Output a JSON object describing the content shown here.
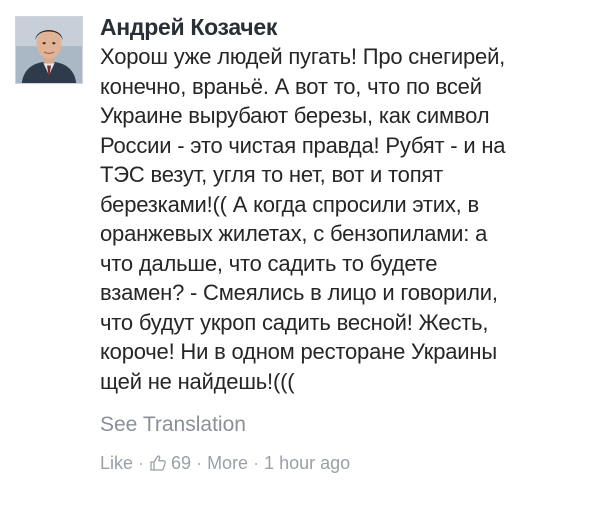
{
  "comment": {
    "author": "Андрей Козачек",
    "lines": [
      "Хорош уже людей пугать! Про снегирей,",
      "конечно, враньё. А вот то, что по всей",
      "Украине вырубают березы, как символ",
      "России - это чистая правда! Рубят - и на",
      "ТЭС везут, угля то нет, вот и топят",
      "березками!(( А когда спросили этих, в",
      "оранжевых жилетах, с бензопилами: а",
      "что дальше, что садить то будете",
      "взамен? - Смеялись в лицо и говорили,",
      "что будут укроп садить весной! Жесть,",
      "короче! Ни в одном ресторане Украины",
      "щей не найдешь!((("
    ],
    "see_translation": "See Translation",
    "actions": {
      "like": "Like",
      "like_count": "69",
      "more": "More",
      "time": "1 hour ago",
      "separator": "·"
    },
    "icons": {
      "avatar": "avatar-photo",
      "likes": "thumbs-up-icon"
    },
    "colors": {
      "meta": "#9ba0a8",
      "text": "#262626"
    }
  }
}
